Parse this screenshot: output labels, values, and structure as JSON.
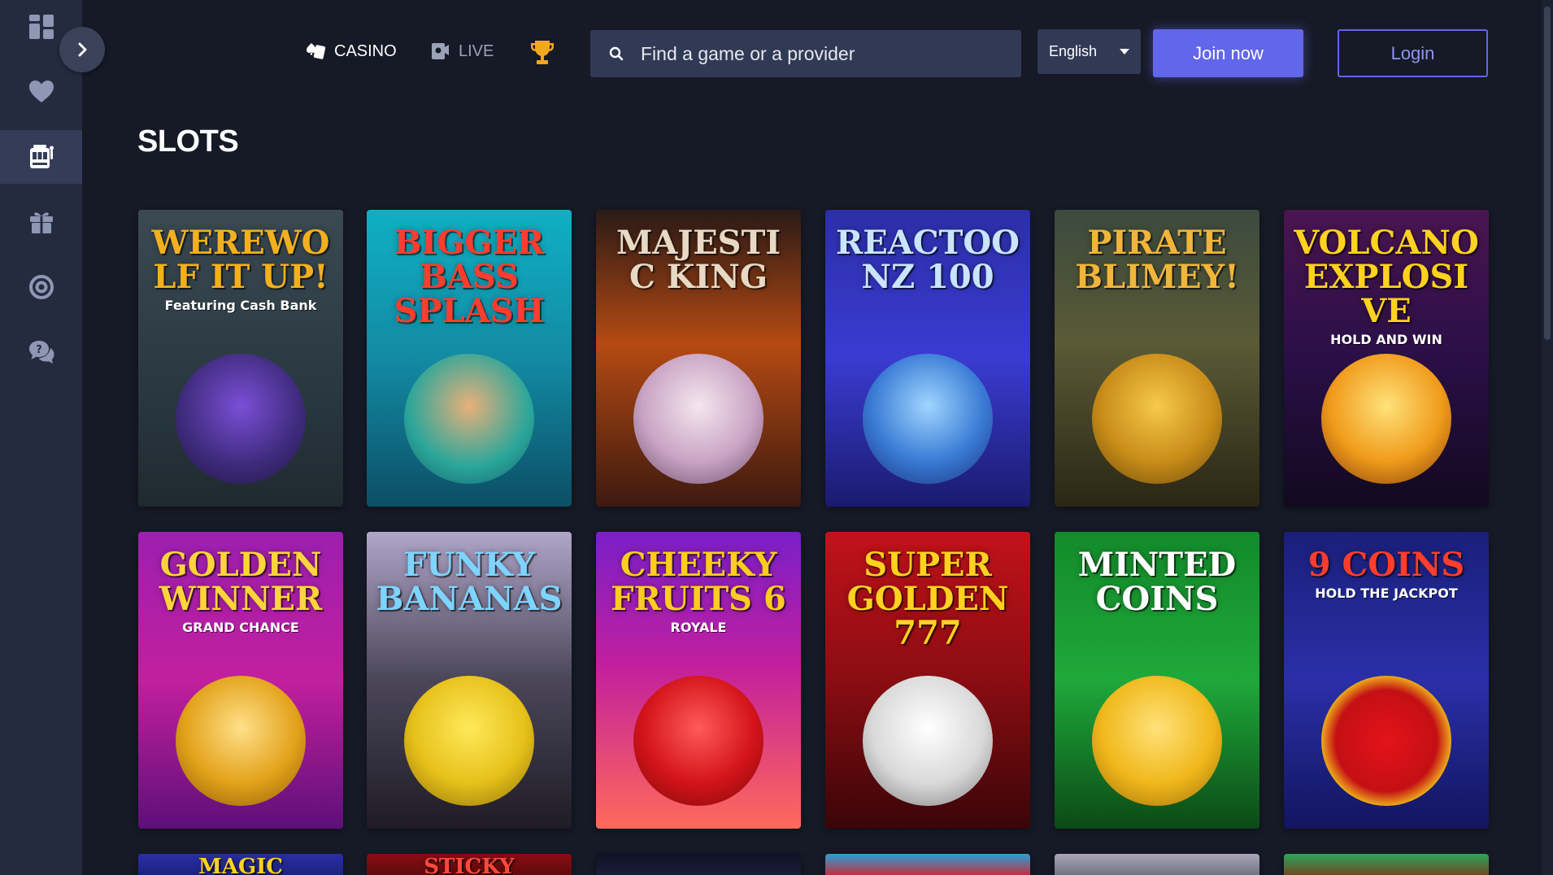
{
  "sidebar": {
    "items": [
      {
        "icon": "dashboard-icon",
        "active": false
      },
      {
        "icon": "heart-icon",
        "active": false
      },
      {
        "icon": "slot-machine-icon",
        "active": true
      },
      {
        "icon": "gift-icon",
        "active": false
      },
      {
        "icon": "lifebuoy-icon",
        "active": false
      },
      {
        "icon": "chat-support-icon",
        "active": false
      }
    ],
    "expand_icon": "chevron-right-icon"
  },
  "header": {
    "nav": {
      "casino_label": "CASINO",
      "live_label": "LIVE",
      "trophy_icon": "trophy-icon"
    },
    "search": {
      "placeholder": "Find a game or a provider"
    },
    "language": {
      "selected": "English"
    },
    "join_label": "Join now",
    "login_label": "Login"
  },
  "page": {
    "title": "SLOTS"
  },
  "colors": {
    "background": "#161a26",
    "sidebar": "#252b3f",
    "accent": "#6266ea",
    "input_bg": "#313a55"
  },
  "games": [
    {
      "title": "Werewolf It Up!",
      "subtitle": "Featuring Cash Bank",
      "bg": "linear-gradient(180deg,#3b4a52 0%,#2b3a42 55%,#1f2a30 100%)",
      "titleColor": "#f2b01e",
      "art": "radial-gradient(circle at 50% 40%,#7a4fd6 0%,#3d2a7a 60%,#20163f 100%)"
    },
    {
      "title": "Bigger Bass Splash",
      "subtitle": "",
      "bg": "linear-gradient(180deg,#0fb0c4 0%,#138aa3 50%,#0b4f66 100%)",
      "titleColor": "#ff3d2e",
      "art": "radial-gradient(circle at 50% 40%,#e9b07a 0%,#2aa69a 60%,#17606a 100%)"
    },
    {
      "title": "Majestic King",
      "subtitle": "",
      "bg": "linear-gradient(180deg,#2a1a17 0%,#b54a12 45%,#3d1910 100%)",
      "titleColor": "#e8d9c4",
      "art": "radial-gradient(circle at 50% 40%,#f4e6ee 0%,#c9a4c4 55%,#6d4c6a 100%)"
    },
    {
      "title": "Reactoonz 100",
      "subtitle": "",
      "bg": "linear-gradient(180deg,#2b2fa8 0%,#3a3bd1 50%,#1a1b6e 100%)",
      "titleColor": "#c9e4ff",
      "art": "radial-gradient(circle at 50% 40%,#9fd6ff 0%,#3a7bd5 55%,#1a2e7a 100%)"
    },
    {
      "title": "Pirate Blimey!",
      "subtitle": "",
      "bg": "linear-gradient(180deg,#3c4a3e 0%,#5a5a36 45%,#2a2614 100%)",
      "titleColor": "#f0b53a",
      "art": "radial-gradient(circle at 50% 40%,#f6c94b 0%,#c98d18 55%,#6b4a0c 100%)"
    },
    {
      "title": "Volcano Explosive",
      "subtitle": "HOLD AND WIN",
      "bg": "linear-gradient(180deg,#4a1550 0%,#2a0f46 50%,#12091f 100%)",
      "titleColor": "#ffd21f",
      "art": "radial-gradient(circle at 50% 40%,#ffe27a 0%,#f09b1b 55%,#7d3b0a 100%)"
    },
    {
      "title": "Golden Winner",
      "subtitle": "GRAND CHANCE",
      "bg": "linear-gradient(180deg,#9c1fb0 0%,#c21f9e 50%,#5e0f7a 100%)",
      "titleColor": "#ffd43b",
      "art": "radial-gradient(circle at 50% 40%,#ffe08a 0%,#e3a21a 55%,#8a5a08 100%)"
    },
    {
      "title": "Funky Bananas",
      "subtitle": "",
      "bg": "linear-gradient(180deg,#b0a6c9 0%,#4a4658 50%,#1f1c26 100%)",
      "titleColor": "#7fd3ff",
      "art": "radial-gradient(circle at 50% 40%,#ffe95a 0%,#e6c11a 55%,#8a6b0a 100%)"
    },
    {
      "title": "Cheeky Fruits 6",
      "subtitle": "ROYALE",
      "bg": "linear-gradient(180deg,#7a1fc9 0%,#c21f9e 45%,#ff6a5a 100%)",
      "titleColor": "#ffcc1f",
      "art": "radial-gradient(circle at 50% 40%,#ff5a5a 0%,#d3131a 55%,#7a0a0a 100%)"
    },
    {
      "title": "Super Golden 777",
      "subtitle": "",
      "bg": "linear-gradient(180deg,#c2121a 0%,#8a0d12 50%,#3a0508 100%)",
      "titleColor": "#ffd21f",
      "art": "radial-gradient(circle at 50% 40%,#ffffff 0%,#d9d9d9 55%,#7a7a7a 100%)"
    },
    {
      "title": "Minted Coins",
      "subtitle": "",
      "bg": "linear-gradient(180deg,#138a2a 0%,#1fa83a 50%,#0b4a16 100%)",
      "titleColor": "#ffffff",
      "art": "radial-gradient(circle at 50% 40%,#ffe27a 0%,#f0b81b 55%,#9a6b0a 100%)"
    },
    {
      "title": "9 Coins",
      "subtitle": "HOLD THE JACKPOT",
      "bg": "linear-gradient(180deg,#1a1f7a 0%,#2a2fa8 50%,#12155e 100%)",
      "titleColor": "#ff3d2e",
      "art": "radial-gradient(circle at 50% 50%,#e3131a 0%,#c40f14 55%,#f0b81b 72%,#c98a0a 100%)"
    },
    {
      "title": "Magic",
      "subtitle": "",
      "bg": "linear-gradient(180deg,#2a2fa8 0%,#1a1f7a 100%)",
      "titleColor": "#ffd21f",
      "art": ""
    },
    {
      "title": "Sticky",
      "subtitle": "",
      "bg": "linear-gradient(180deg,#8a0d12 0%,#5a0a0e 100%)",
      "titleColor": "#ff4a3a",
      "art": ""
    },
    {
      "title": "",
      "subtitle": "",
      "bg": "linear-gradient(180deg,#0e1224 0%,#1a1f3a 100%)",
      "titleColor": "#ffffff",
      "art": ""
    },
    {
      "title": "",
      "subtitle": "",
      "bg": "linear-gradient(180deg,#2a9fd6 0%,#d61f2a 100%)",
      "titleColor": "#ffffff",
      "art": ""
    },
    {
      "title": "",
      "subtitle": "",
      "bg": "linear-gradient(180deg,#a8a6b8 0%,#6b6a7a 100%)",
      "titleColor": "#ffffff",
      "art": ""
    },
    {
      "title": "",
      "subtitle": "",
      "bg": "linear-gradient(180deg,#2aa65a 0%,#7a3a1a 100%)",
      "titleColor": "#ffffff",
      "art": ""
    }
  ]
}
